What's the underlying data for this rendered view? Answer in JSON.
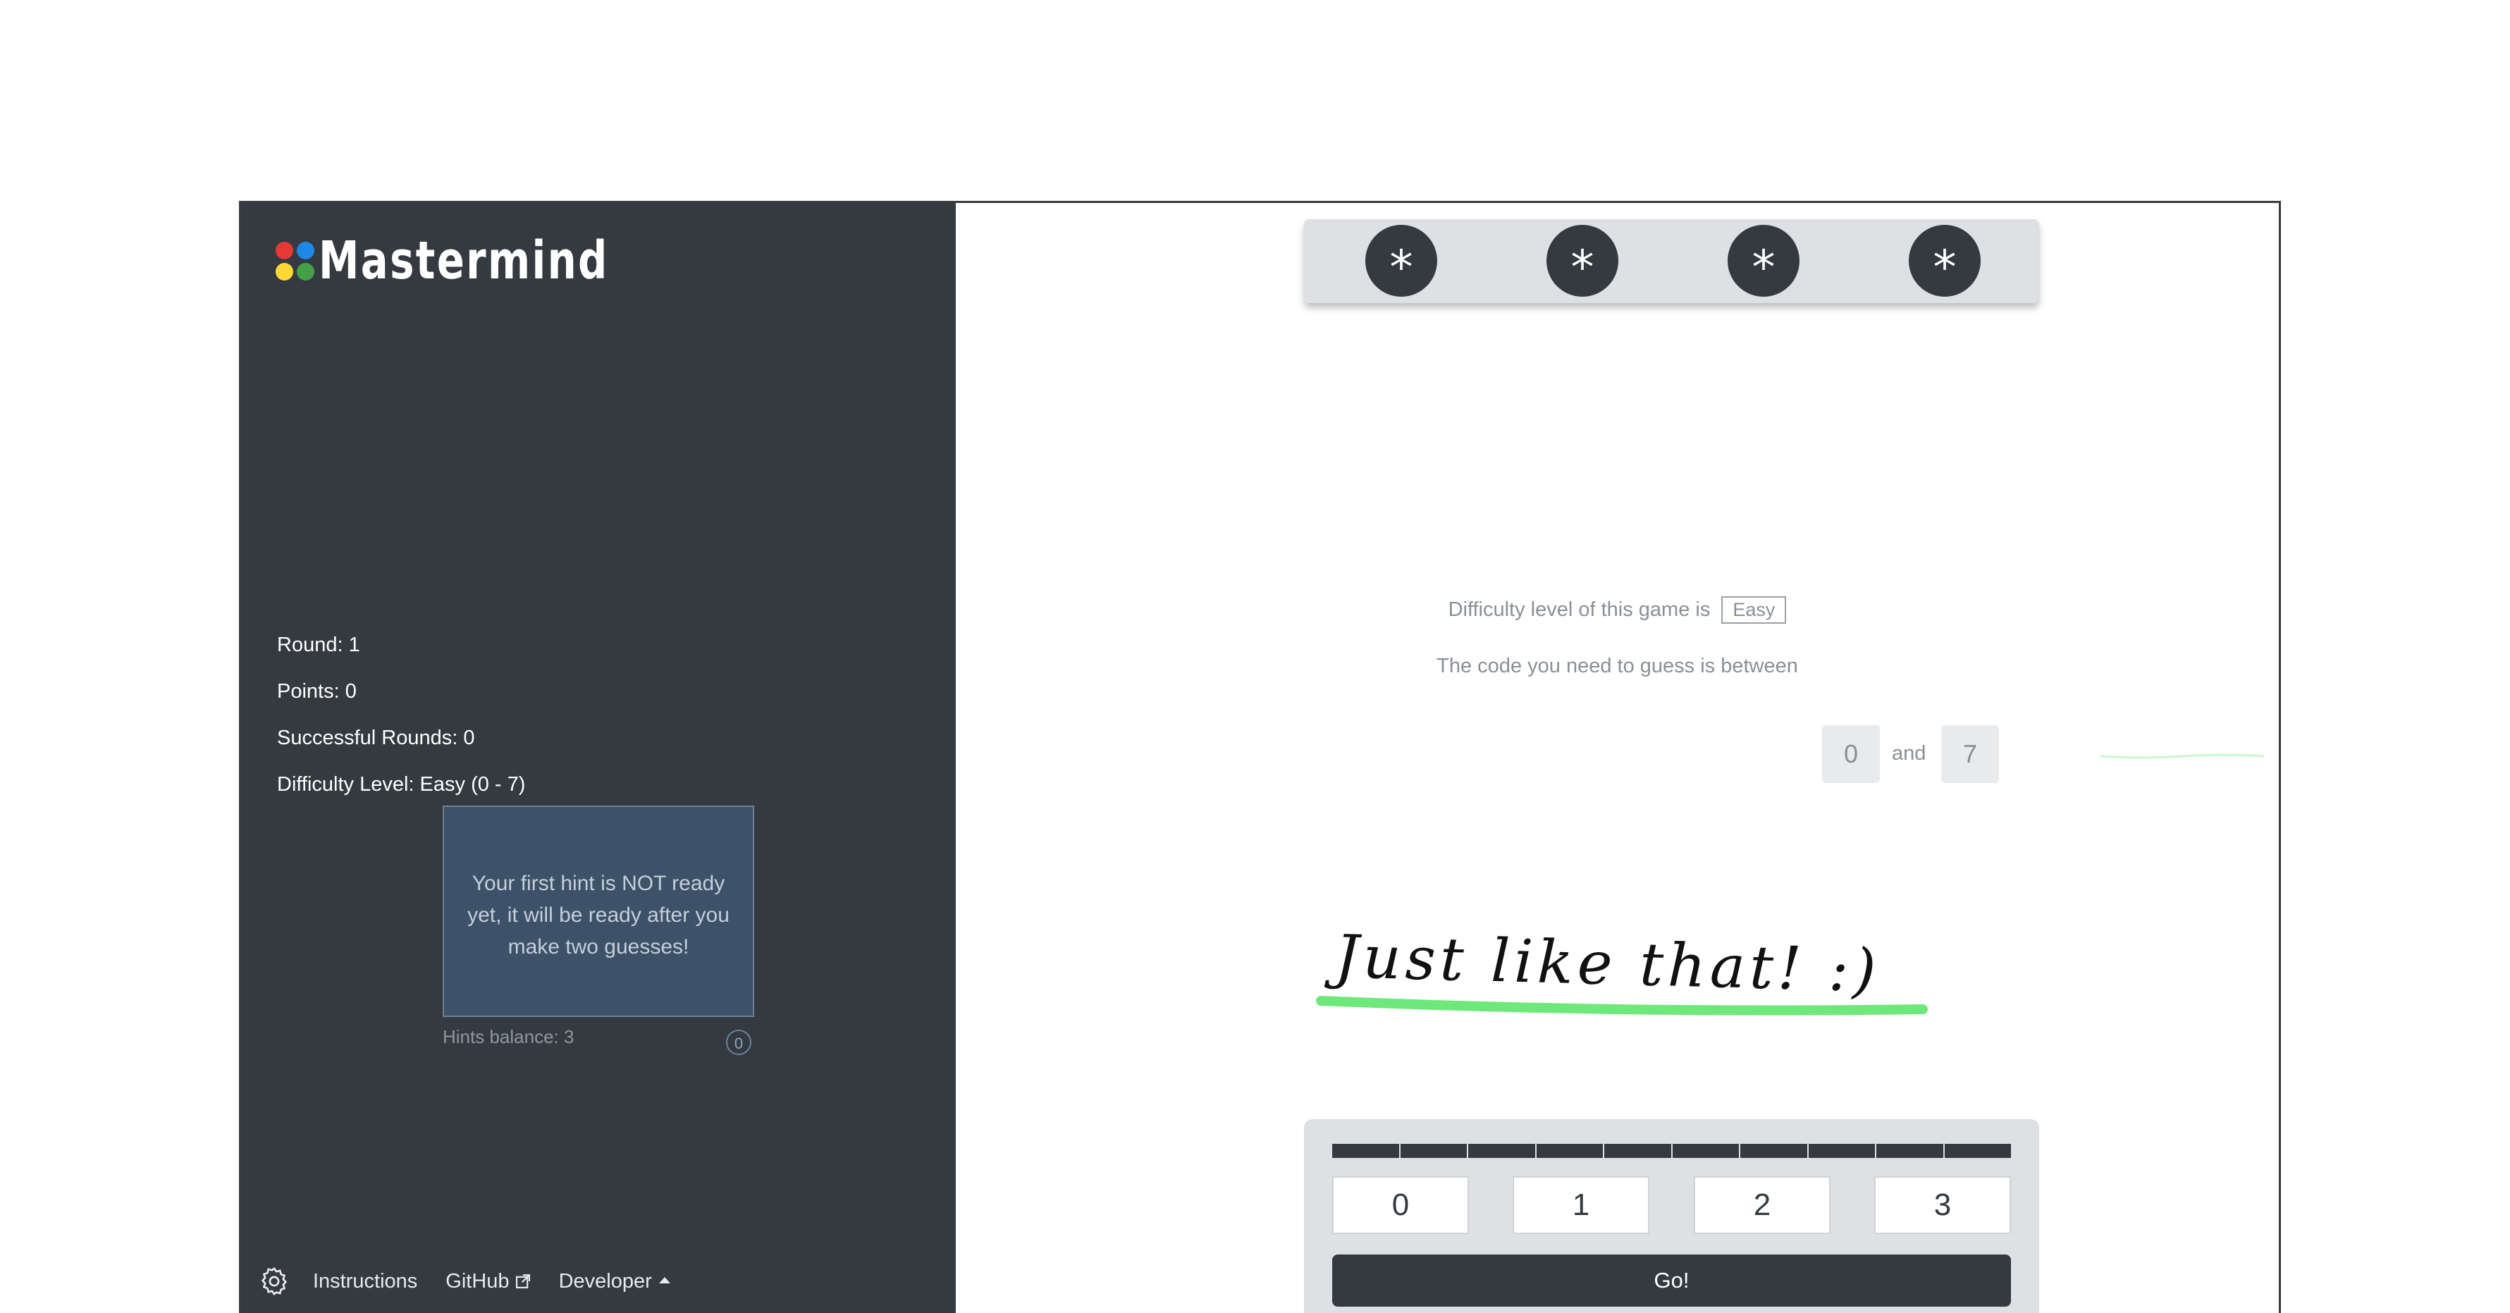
{
  "app": {
    "title": "Mastermind",
    "logo_dot_colors": [
      "#e53935",
      "#1e88e5",
      "#fdd835",
      "#43a047"
    ]
  },
  "sidebar": {
    "stats": {
      "round": "Round: 1",
      "points": "Points: 0",
      "successful_rounds": "Successful Rounds: 0",
      "difficulty": "Difficulty Level: Easy (0 - 7)"
    },
    "hint_box": {
      "text": "Your first hint is NOT ready yet, it will be ready after you make two guesses!",
      "balance": "Hints balance: 3",
      "counter": "0"
    },
    "footer": {
      "settings_icon": "gear-icon",
      "instructions": "Instructions",
      "github": "GitHub",
      "github_icon": "external-link-icon",
      "developer": "Developer",
      "developer_icon": "caret-up-icon"
    }
  },
  "main": {
    "secret_code": [
      "*",
      "*",
      "*",
      "*"
    ],
    "info": {
      "difficulty_prefix": "Difficulty level of this game is",
      "difficulty_value": "Easy",
      "range_text": "The code you need to guess is between",
      "range_min": "0",
      "range_and": "and",
      "range_max": "7"
    },
    "handwriting": "Just like that! :)",
    "accent_green": "#6ee87a",
    "guess_inputs": [
      "0",
      "1",
      "2",
      "3"
    ],
    "go_button": "Go!",
    "attempts_segments": 10
  }
}
